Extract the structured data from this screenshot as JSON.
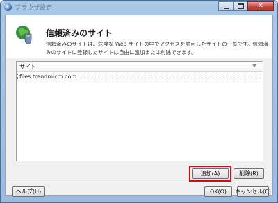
{
  "window": {
    "title": "ブラウザ設定",
    "controls": {
      "minimize": "minimize-icon",
      "maximize": "maximize-icon",
      "close": "close-icon"
    }
  },
  "header": {
    "icon": "shield-globe-icon",
    "heading": "信頼済みのサイト",
    "description": "信頼済みのサイトは、危険な Web サイトの中でアクセスを許可したサイトの一覧です。信頼済みのサイトに登録したサイトは自由に追加または削除できます。"
  },
  "site_list": {
    "column_header": "サイト",
    "sites": [
      "files.trendmicro.com"
    ]
  },
  "buttons": {
    "add": "追加(A)",
    "delete": "削除(R)",
    "help": "ヘルプ(H)",
    "ok": "OK(O)",
    "cancel": "キャンセル(C)"
  },
  "colors": {
    "highlight": "#e0001a",
    "titlebar": "#a9c7e6",
    "close_button": "#c0473b"
  }
}
